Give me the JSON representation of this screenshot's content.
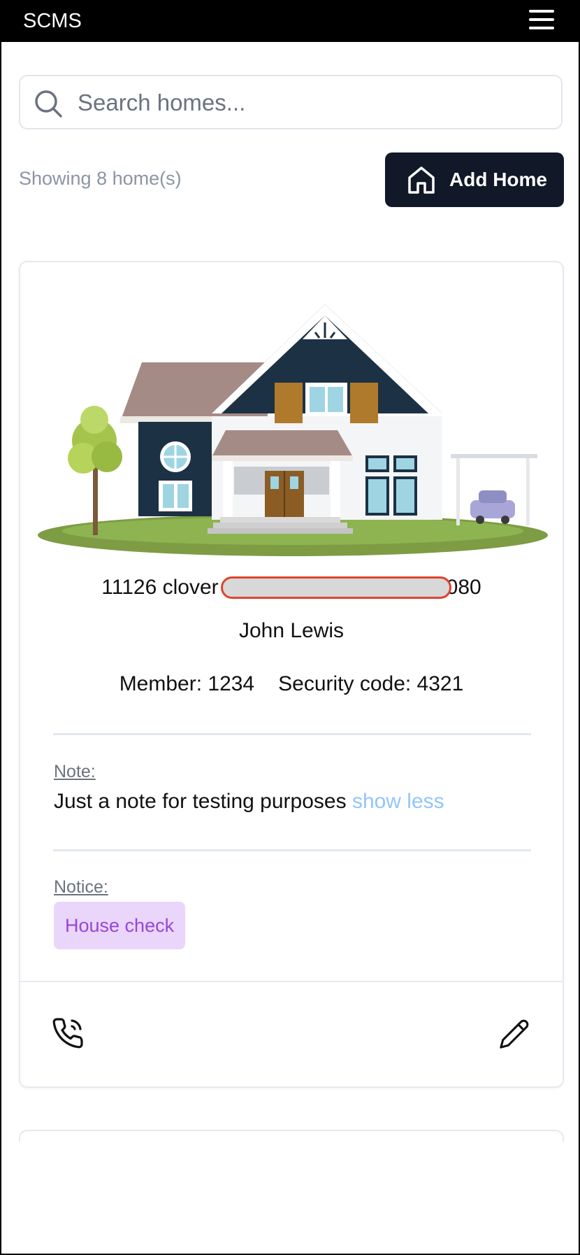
{
  "header": {
    "brand": "SCMS",
    "menu_icon": "hamburger-menu-icon"
  },
  "search": {
    "placeholder": "Search homes...",
    "value": "",
    "icon": "search-icon"
  },
  "toolbar": {
    "count_text": "Showing 8 home(s)",
    "add_label": "Add Home",
    "add_icon": "home-icon"
  },
  "homes": [
    {
      "image": "house-illustration",
      "address_start": "11126 clover",
      "address_end": "080",
      "owner": "John Lewis",
      "member_text": "Member: 1234",
      "security_text": "Security code: 4321",
      "note_label": "Note:",
      "note": "Just a note for testing purposes",
      "note_toggle": "show less",
      "notice_label": "Notice:",
      "notice_badge": "House check",
      "actions": {
        "call_icon": "phone-call-icon",
        "edit_icon": "pencil-icon"
      }
    }
  ],
  "colors": {
    "header_bg": "#000000",
    "button_bg": "#111827",
    "link": "#93c5fd",
    "badge_bg": "#ead5fb",
    "badge_text": "#9747d8",
    "redaction_outline": "#e0432e"
  }
}
